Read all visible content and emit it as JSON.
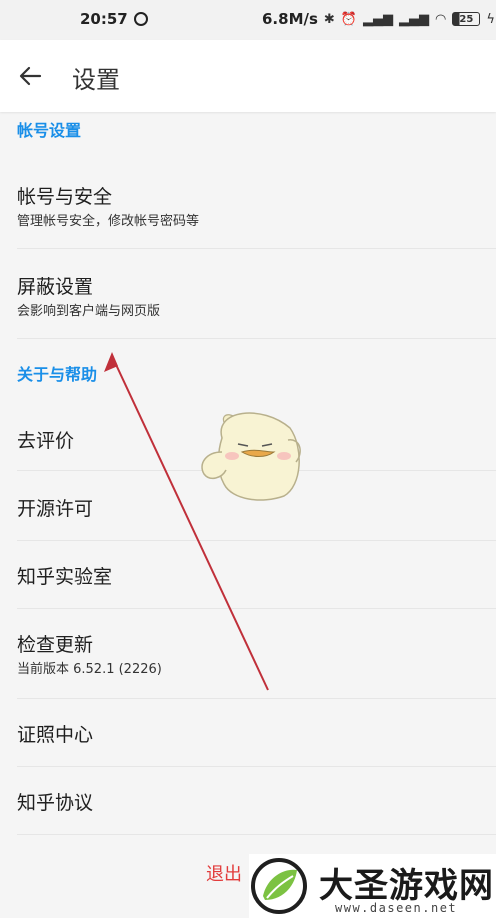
{
  "status_bar": {
    "time": "20:57",
    "speed": "6.8M/s",
    "battery": "25"
  },
  "header": {
    "title": "设置"
  },
  "sections": {
    "account": {
      "header": "帐号设置",
      "items": [
        {
          "title": "帐号与安全",
          "subtitle": "管理帐号安全，修改帐号密码等"
        },
        {
          "title": "屏蔽设置",
          "subtitle": "会影响到客户端与网页版"
        }
      ]
    },
    "about": {
      "header": "关于与帮助",
      "items": [
        {
          "title": "去评价"
        },
        {
          "title": "开源许可"
        },
        {
          "title": "知乎实验室"
        },
        {
          "title": "检查更新",
          "subtitle": "当前版本 6.52.1 (2226)"
        },
        {
          "title": "证照中心"
        },
        {
          "title": "知乎协议"
        }
      ]
    }
  },
  "logout_label": "退出",
  "watermark": {
    "title": "大圣游戏网",
    "url": "www.daseen.net"
  },
  "colors": {
    "accent": "#1a8fe8",
    "logout": "#e23c3c",
    "annotation_arrow": "#c0303a"
  }
}
